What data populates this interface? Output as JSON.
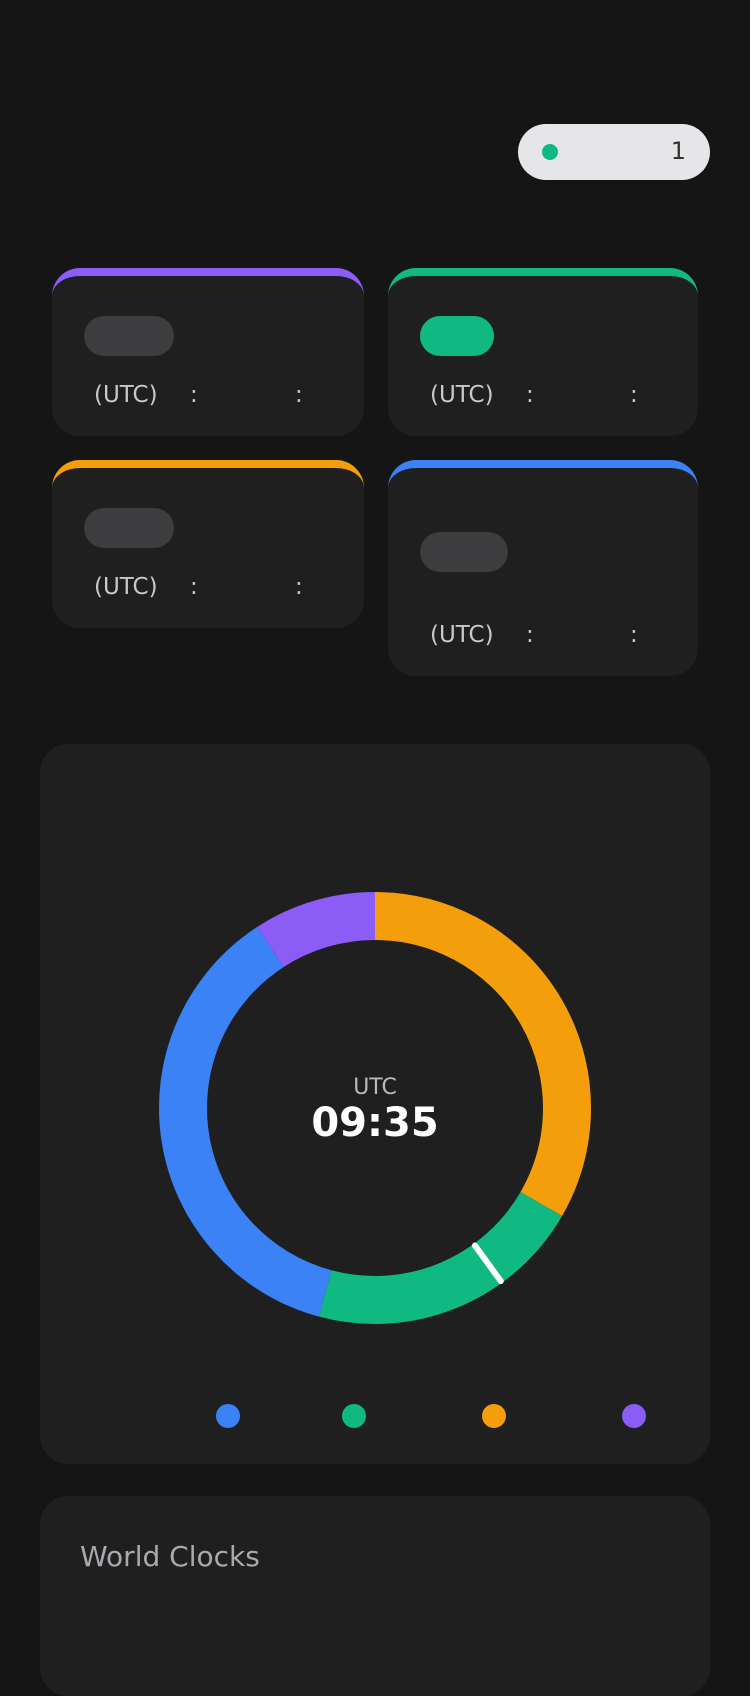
{
  "status_pill": {
    "count": "1",
    "dot_color": "#10b981"
  },
  "zones": [
    {
      "label": "(UTC)",
      "accent": "#8b5cf6",
      "active": false
    },
    {
      "label": "(UTC)",
      "accent": "#10b981",
      "active": true
    },
    {
      "label": "(UTC)",
      "accent": "#f59e0b",
      "active": false
    },
    {
      "label": "(UTC)",
      "accent": "#3b82f6",
      "active": false
    }
  ],
  "dial": {
    "zone_label": "UTC",
    "time": "09:35",
    "hand_angle_deg": 144,
    "segments": [
      {
        "color": "#f59e0b",
        "start_deg": 0,
        "end_deg": 120
      },
      {
        "color": "#10b981",
        "start_deg": 120,
        "end_deg": 195
      },
      {
        "color": "#3b82f6",
        "start_deg": 195,
        "end_deg": 327
      },
      {
        "color": "#8b5cf6",
        "start_deg": 327,
        "end_deg": 360
      }
    ]
  },
  "legend": [
    {
      "color": "#3b82f6"
    },
    {
      "color": "#10b981"
    },
    {
      "color": "#f59e0b"
    },
    {
      "color": "#8b5cf6"
    }
  ],
  "world_clocks": {
    "title": "World Clocks"
  }
}
